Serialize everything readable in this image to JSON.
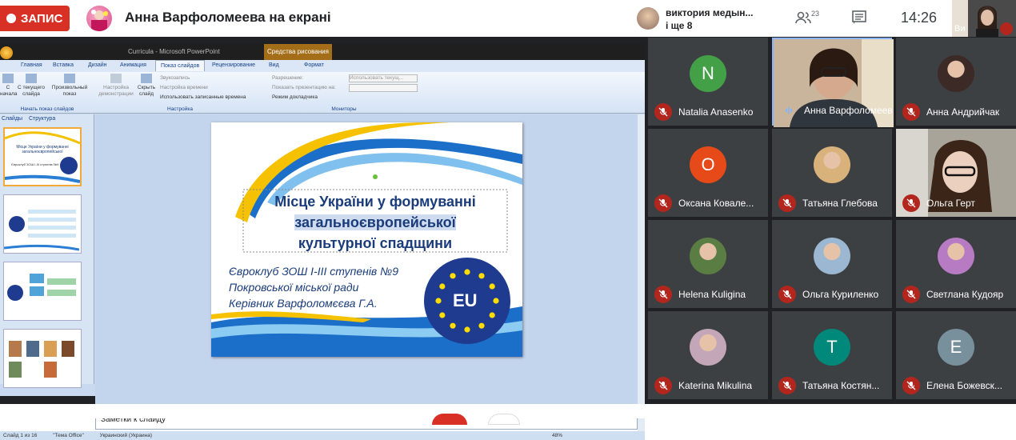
{
  "top": {
    "record_label": "ЗАПИС",
    "presenter_title": "Анна Варфоломеева на екрані"
  },
  "notification": {
    "name": "виктория медын...",
    "more": "і ще 8"
  },
  "header": {
    "participants_count": "23",
    "time": "14:26",
    "self_label": "Ви"
  },
  "ppt": {
    "window_title": "Curricula - Microsoft PowerPoint",
    "drawing_tools": "Средства рисования",
    "tabs": [
      "Главная",
      "Вставка",
      "Дизайн",
      "Анимация",
      "Показ слайдов",
      "Рецензирование",
      "Вид",
      "Формат"
    ],
    "ribbon": {
      "from_start": "С начала",
      "from_current": "С текущего слайда",
      "custom": "Произвольный показ",
      "group1": "Начать показ слайдов",
      "setup": "Настройка демонстрации",
      "hide": "Скрыть слайд",
      "record": "Звукозапись",
      "timing": "Настройка времени",
      "use_timing": "Использовать записанные времена",
      "group2": "Настройка",
      "resolution": "Разрешение:",
      "resolution_val": "Использовать текущ...",
      "show_on": "Показать презентацию на:",
      "presenter": "Режим докладчика",
      "group3": "Мониторы"
    },
    "panel_tabs": [
      "Слайды",
      "Структура"
    ],
    "thumb_texts": [
      "Місце України у формуванні загальноєвропейської культурної спадщини",
      "Євроклуб ЗОШ І-ІІІ ступенів №9"
    ],
    "slide": {
      "title1": "Місце України у формуванні",
      "title2": "загальноєвропейської",
      "title3": "культурної спадщини",
      "sub1": "Євроклуб ЗОШ І-ІІІ ступенів №9",
      "sub2": "Покровської міської ради",
      "sub3": "Керівник Варфоломєєва Г.А.",
      "eu": "EU"
    },
    "notes": "Заметки к слайду",
    "status": {
      "slide": "Слайд 1 из 16",
      "theme": "\"Тема Office\"",
      "lang": "Украинский (Украина)",
      "zoom": "48%"
    }
  },
  "participants": [
    {
      "name": "Natalia Anasenko",
      "initial": "N",
      "color": "#43a047"
    },
    {
      "name": "Анна Варфоломеева"
    },
    {
      "name": "Анна Андрийчак"
    },
    {
      "name": "Оксана Ковале...",
      "initial": "О",
      "color": "#e64a19"
    },
    {
      "name": "Татьяна Глебова"
    },
    {
      "name": "Ольга Герт"
    },
    {
      "name": "Helena Kuligina"
    },
    {
      "name": "Ольга Куриленко"
    },
    {
      "name": "Светлана Кудояр"
    },
    {
      "name": "Katerina Mikulina"
    },
    {
      "name": "Татьяна Костян...",
      "initial": "Т",
      "color": "#00897b"
    },
    {
      "name": "Елена Божевск...",
      "initial": "Е",
      "color": "#78909c"
    }
  ]
}
